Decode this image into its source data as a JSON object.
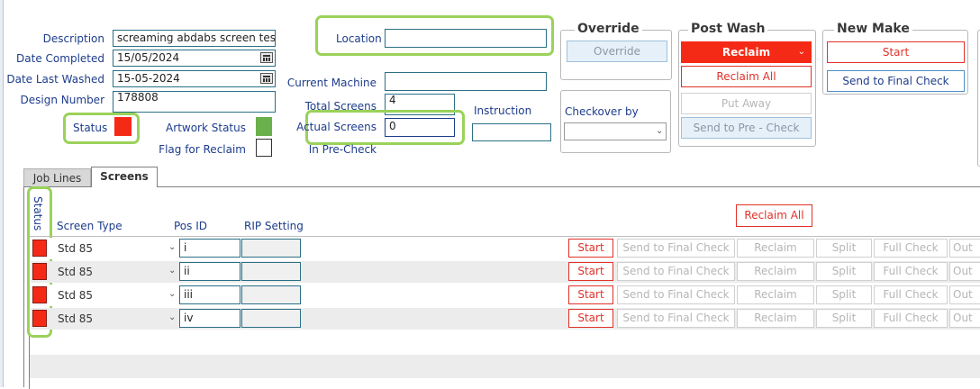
{
  "form": {
    "description_label": "Description",
    "description_value": "screaming abdabs screen test",
    "date_completed_label": "Date Completed",
    "date_completed_value": "15/05/2024",
    "date_last_washed_label": "Date Last Washed",
    "date_last_washed_value": "15-05-2024",
    "design_number_label": "Design Number",
    "design_number_value": "178808",
    "status_label": "Status",
    "artwork_status_label": "Artwork Status",
    "flag_for_reclaim_label": "Flag for Reclaim",
    "location_label": "Location",
    "location_value": "",
    "current_machine_label": "Current Machine",
    "current_machine_value": "",
    "total_screens_label": "Total Screens",
    "total_screens_value": "4",
    "actual_screens_label": "Actual Screens",
    "actual_screens_value": "0",
    "in_pre_check_label": "In Pre-Check",
    "instruction_label": "Instruction",
    "instruction_value": "",
    "checkover_by_label": "Checkover by",
    "checkover_by_value": ""
  },
  "colors": {
    "status_red": "#f52a16",
    "artwork_green": "#6ab04c",
    "highlight_green": "#9ad25a",
    "label_blue": "#1d3c8c"
  },
  "groups": {
    "override": {
      "title": "Override",
      "button": "Override"
    },
    "post_wash": {
      "title": "Post Wash",
      "reclaim": "Reclaim",
      "reclaim_all": "Reclaim All",
      "put_away": "Put Away",
      "send_to_pre_check": "Send to Pre - Check"
    },
    "new_make": {
      "title": "New Make",
      "start": "Start",
      "send_to_final_check": "Send to Final Check"
    }
  },
  "tabs": [
    {
      "label": "Job Lines",
      "active": false
    },
    {
      "label": "Screens",
      "active": true
    }
  ],
  "grid": {
    "status_header": "Status",
    "screen_type_header": "Screen Type",
    "pos_id_header": "Pos ID",
    "rip_setting_header": "RIP Setting",
    "reclaim_all": "Reclaim All",
    "row_buttons": {
      "start": "Start",
      "send_to_final_check": "Send to Final Check",
      "reclaim": "Reclaim",
      "split": "Split",
      "full_check": "Full Check",
      "out": "Out"
    },
    "rows": [
      {
        "screen_type": "Std 85",
        "pos_id": "i",
        "rip_setting": ""
      },
      {
        "screen_type": "Std 85",
        "pos_id": "ii",
        "rip_setting": ""
      },
      {
        "screen_type": "Std 85",
        "pos_id": "iii",
        "rip_setting": ""
      },
      {
        "screen_type": "Std 85",
        "pos_id": "iv",
        "rip_setting": ""
      }
    ]
  }
}
